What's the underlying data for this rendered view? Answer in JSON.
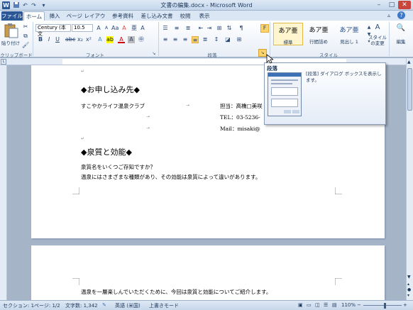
{
  "window": {
    "title": "文書の編集.docx - Microsoft Word",
    "qat_icons": [
      "word-logo-icon",
      "save-icon",
      "undo-icon",
      "redo-icon",
      "customize-qat-icon"
    ],
    "controls": [
      "minimize-icon",
      "maximize-icon",
      "close-icon"
    ]
  },
  "tabs": [
    {
      "label": "ファイル"
    },
    {
      "label": "ホーム"
    },
    {
      "label": "挿入"
    },
    {
      "label": "ページ レイアウト"
    },
    {
      "label": "参考資料"
    },
    {
      "label": "差し込み文書"
    },
    {
      "label": "校閲"
    },
    {
      "label": "表示"
    }
  ],
  "ribbon": {
    "clipboard": {
      "paste_label": "貼り付け",
      "group_label": "クリップボード"
    },
    "font": {
      "font_name": "Century (本文",
      "font_size": "10.5",
      "group_label": "フォント"
    },
    "paragraph": {
      "group_label": "段落"
    },
    "styles": {
      "items": [
        {
          "sample": "あア亜",
          "name": "標準"
        },
        {
          "sample": "あア亜",
          "name": "行間詰め"
        },
        {
          "sample": "あア亜",
          "name": "見出し 1"
        }
      ],
      "change_label": "スタイルの変更",
      "group_label": "スタイル"
    },
    "editing": {
      "label": "編集"
    }
  },
  "tooltip": {
    "title": "段落",
    "description": "[段落] ダイアログ ボックスを表示します。"
  },
  "document": {
    "section1_heading": "◆お申し込み先◆",
    "club_name": "すこやかライフ温泉クラブ",
    "contact_name": "担当：高橋□美咲",
    "tel": "TEL：03-5236-",
    "mail": "Mail：misaki@",
    "section2_heading": "◆泉質と効能◆",
    "question": "泉質名をいくつご存知ですか？",
    "body1": "温泉にはさまざまな種類があり、その効能は泉質によって違いがあります。",
    "page2_text": "温泉を一層楽しんでいただくために、今回は泉質と効能についてご紹介します。",
    "para_mark": "↵",
    "tab_mark": "→"
  },
  "status": {
    "section": "セクション: 1",
    "page": "ページ: 1/2",
    "words": "文字数: 1,342",
    "language": "英語 (米国)",
    "mode": "上書きモード",
    "zoom": "110%"
  }
}
